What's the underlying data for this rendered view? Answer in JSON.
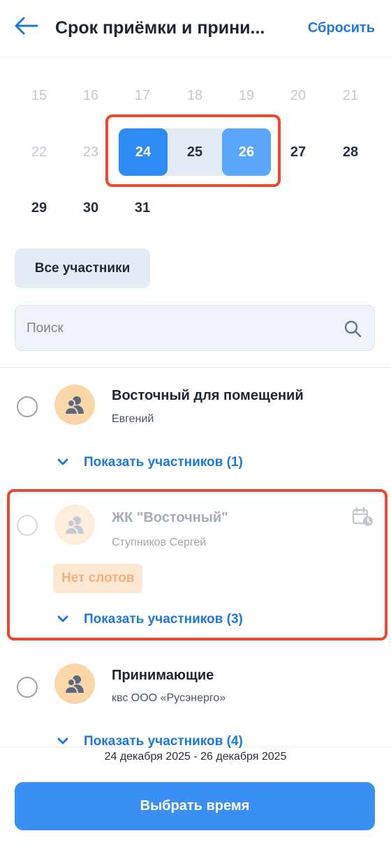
{
  "header": {
    "title": "Срок приёмки и прини...",
    "reset_label": "Сбросить"
  },
  "calendar": {
    "row1": [
      "15",
      "16",
      "17",
      "18",
      "19",
      "20",
      "21"
    ],
    "row2": [
      "22",
      "23",
      "24",
      "25",
      "26",
      "27",
      "28"
    ],
    "row3": [
      "29",
      "30",
      "31"
    ],
    "selected_start": "24",
    "selected_end": "26"
  },
  "filter": {
    "all_participants_label": "Все участники"
  },
  "search": {
    "placeholder": "Поиск"
  },
  "items": [
    {
      "title": "Восточный для помещений",
      "subtitle": "Евгений",
      "show_label": "Показать участников (1)"
    },
    {
      "title": "ЖК \"Восточный\"",
      "subtitle": "Ступников Сергей",
      "badge": "Нет слотов",
      "show_label": "Показать участников (3)"
    },
    {
      "title": "Принимающие",
      "subtitle": "квс ООО «Русэнерго»",
      "show_label": "Показать участников (4)"
    }
  ],
  "footer": {
    "date_range": "24 декабря 2025 - 26 декабря 2025",
    "submit_label": "Выбрать время"
  },
  "colors": {
    "accent": "#1d78d8",
    "selected_start": "#2f8cf5",
    "selected_end": "#5aa6f8",
    "highlight_border": "#e8492b"
  }
}
